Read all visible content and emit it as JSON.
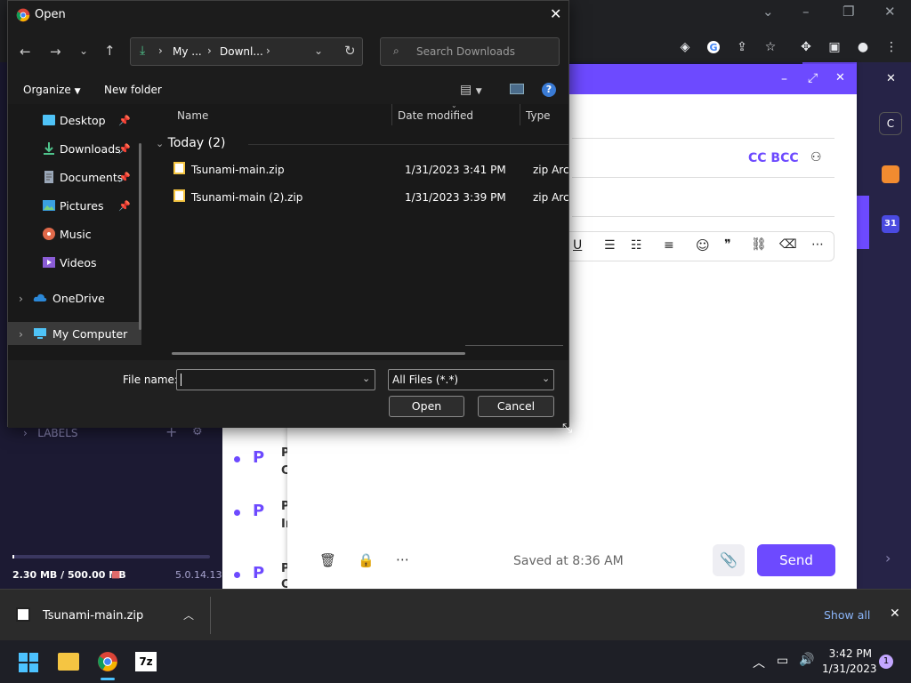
{
  "dialog": {
    "title": "Open",
    "breadcrumb": [
      "My ...",
      "Downl..."
    ],
    "search_placeholder": "Search Downloads",
    "organize_label": "Organize",
    "new_folder_label": "New folder",
    "nav": [
      {
        "label": "Desktop",
        "pinned": true
      },
      {
        "label": "Downloads",
        "pinned": true
      },
      {
        "label": "Documents",
        "pinned": true
      },
      {
        "label": "Pictures",
        "pinned": true
      },
      {
        "label": "Music",
        "pinned": false
      },
      {
        "label": "Videos",
        "pinned": false
      },
      {
        "label": "OneDrive",
        "pinned": false
      },
      {
        "label": "My Computer",
        "pinned": false
      }
    ],
    "columns": {
      "name": "Name",
      "date": "Date modified",
      "type": "Type"
    },
    "group_label": "Today (2)",
    "files": [
      {
        "name": "Tsunami-main.zip",
        "date": "1/31/2023 3:41 PM",
        "type": "zip Archive"
      },
      {
        "name": "Tsunami-main (2).zip",
        "date": "1/31/2023 3:39 PM",
        "type": "zip Archive"
      }
    ],
    "file_name_label": "File name:",
    "file_name_value": "",
    "filter_value": "All Files (*.*)",
    "open_label": "Open",
    "cancel_label": "Cancel"
  },
  "mail": {
    "cc_bcc": "CC BCC",
    "labels_heading": "LABELS",
    "storage": "2.30 MB / 500.00 MB",
    "version": "5.0.14.13",
    "saved": "Saved at 8:36 AM",
    "send": "Send",
    "list_avatar": "P",
    "list_lines": [
      [
        "P",
        "C"
      ],
      [
        "P",
        "In"
      ],
      [
        "P",
        "C"
      ]
    ],
    "calendar_day": "31",
    "account_initial": "C"
  },
  "download_bar": {
    "file": "Tsunami-main.zip",
    "show_all": "Show all"
  },
  "taskbar": {
    "time": "3:42 PM",
    "date": "1/31/2023",
    "notifications": "1"
  },
  "colors": {
    "accent": "#6d4aff",
    "dialog_bg": "#202020",
    "folder_blue": "#4fc3f7"
  }
}
